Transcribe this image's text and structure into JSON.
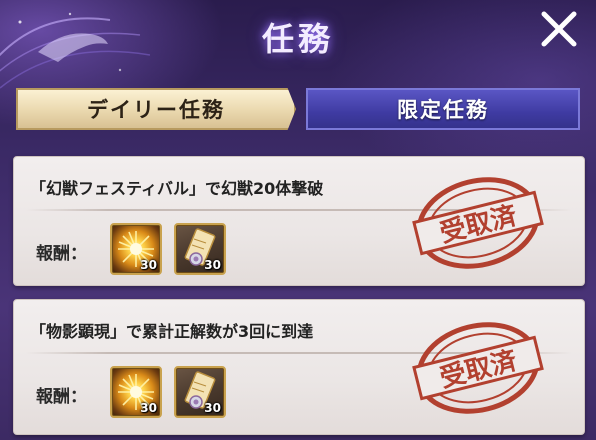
{
  "header": {
    "title": "任務"
  },
  "tabs": [
    {
      "label": "デイリー任務",
      "active": true
    },
    {
      "label": "限定任務",
      "active": false
    }
  ],
  "missions": [
    {
      "description": "「幻獣フェスティバル」で幻獣20体撃破",
      "reward_label": "報酬：",
      "rewards": [
        {
          "icon": "sparkle-burst-icon",
          "quantity": "30"
        },
        {
          "icon": "scroll-ticket-icon",
          "quantity": "30"
        }
      ],
      "status": "受取済"
    },
    {
      "description": "「物影顕現」で累計正解数が3回に到達",
      "reward_label": "報酬：",
      "rewards": [
        {
          "icon": "sparkle-burst-icon",
          "quantity": "30"
        },
        {
          "icon": "scroll-ticket-icon",
          "quantity": "30"
        }
      ],
      "status": "受取済"
    }
  ],
  "colors": {
    "background": "#3b2a66",
    "tab_active": "#ead8ae",
    "tab_inactive": "#3f3ba2",
    "stamp": "#b2402f"
  }
}
